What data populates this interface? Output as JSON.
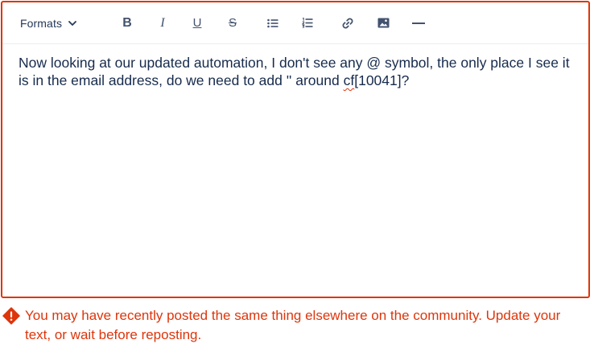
{
  "toolbar": {
    "formats_label": "Formats",
    "buttons": {
      "bold": "B",
      "italic": "I",
      "underline": "U",
      "strikethrough": "S"
    },
    "icons": [
      "chevron-down-icon",
      "bold-icon",
      "italic-icon",
      "underline-icon",
      "strikethrough-icon",
      "bullet-list-icon",
      "numbered-list-icon",
      "link-icon",
      "image-icon",
      "horizontal-rule-icon"
    ]
  },
  "editor": {
    "text_before": "Now looking at our updated automation, I don't see any @ symbol, the only place I see it is in the email address, do we need to add '' around ",
    "text_misspelled": "cf",
    "text_after": "[10041]?"
  },
  "error": {
    "message": "You may have recently posted the same thing elsewhere on the community. Update your text, or wait before reposting.",
    "icon": "error-icon"
  },
  "colors": {
    "error": "#de350b",
    "text": "#172b4d",
    "icon": "#42526e"
  }
}
